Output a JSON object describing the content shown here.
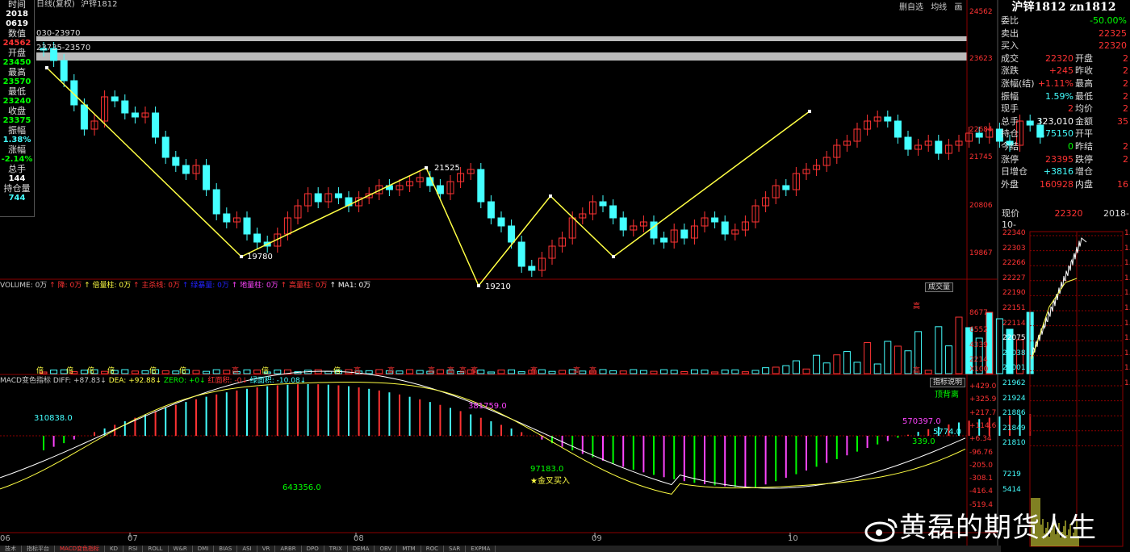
{
  "window": {
    "period": "日线(复权)",
    "symbol": "沪锌1812",
    "top_buttons": [
      "删自选",
      "均线",
      "画"
    ]
  },
  "info_panel": [
    {
      "label": "时间",
      "value": "2018\n0619",
      "color": "#ffffff"
    },
    {
      "label": "数值",
      "value": "24562",
      "color": "#ff3333"
    },
    {
      "label": "开盘",
      "value": "23450",
      "color": "#00ff00"
    },
    {
      "label": "最高",
      "value": "23570",
      "color": "#00ff00"
    },
    {
      "label": "最低",
      "value": "23240",
      "color": "#00ff00"
    },
    {
      "label": "收盘",
      "value": "23375",
      "color": "#00ff00"
    },
    {
      "label": "振幅",
      "value": "1.38%",
      "color": "#44ffff"
    },
    {
      "label": "涨幅",
      "value": "-2.14%",
      "color": "#00ff00"
    },
    {
      "label": "总手",
      "value": "144",
      "color": "#ffffff"
    },
    {
      "label": "持仓量",
      "value": "744",
      "color": "#44ffff"
    }
  ],
  "price_lines": [
    "030-23970",
    "23735-23570"
  ],
  "price_axis": [
    "24562",
    "23623",
    "22684",
    "21745",
    "20806",
    "19867"
  ],
  "zigzag_labels": [
    "19780",
    "21525",
    "19210"
  ],
  "volume": {
    "header": [
      {
        "text": "VOLUME: 0万",
        "color": "#cccccc"
      },
      {
        "text": "↑ 降: 0万",
        "color": "#ff3333"
      },
      {
        "text": "↑ 倍量柱: 0万",
        "color": "#ffff44"
      },
      {
        "text": "↑ 主杀线: 0万",
        "color": "#ff3333"
      },
      {
        "text": "↑ 绿暴量: 0万",
        "color": "#2222ff"
      },
      {
        "text": "↑ 地量柱: 0万",
        "color": "#ff44ff"
      },
      {
        "text": "↑ 高量柱: 0万",
        "color": "#ff3333"
      },
      {
        "text": "↑ MA1: 0万",
        "color": "#ffffff"
      }
    ],
    "button": "成交量",
    "axis": [
      "8677",
      "6552",
      "4339",
      "2214",
      "X100"
    ],
    "markers": [
      "倍",
      "倍",
      "倍",
      "倍",
      "倍",
      "倍",
      "高",
      "倍",
      "倍",
      "高",
      "高",
      "高",
      "高",
      "高",
      "高",
      "高",
      "高",
      "高",
      "高",
      "高"
    ]
  },
  "macd": {
    "header": [
      {
        "text": "MACD变色指标 DIFF: +87.83↓",
        "color": "#cccccc"
      },
      {
        "text": "DEA: +92.88↓",
        "color": "#ffff44"
      },
      {
        "text": "ZERO: +0↓",
        "color": "#00ff00"
      },
      {
        "text": "红面积: -0↓",
        "color": "#ff3333"
      },
      {
        "text": "绿面积: -10.08↓",
        "color": "#44ffff"
      }
    ],
    "button": "指标说明",
    "axis": [
      "+429.0",
      "+325.9",
      "+217.7",
      "+114.6",
      "+6.34",
      "-96.76",
      "-205.0",
      "-308.1",
      "-416.4",
      "-519.4"
    ],
    "labels": [
      {
        "text": "310838.0",
        "color": "#44ffff"
      },
      {
        "text": "381759.0",
        "color": "#ff44ff"
      },
      {
        "text": "643356.0",
        "color": "#00ff00"
      },
      {
        "text": "97183.0",
        "color": "#00ff00"
      },
      {
        "text": "金叉买入",
        "color": "#ffff44"
      },
      {
        "text": "570397.0",
        "color": "#ff44ff"
      },
      {
        "text": "5774.0",
        "color": "#44ffff"
      },
      {
        "text": "339.0",
        "color": "#00ff00"
      },
      {
        "text": "顶背离",
        "color": "#00ff00"
      }
    ]
  },
  "x_axis": [
    "06",
    "07",
    "08",
    "09",
    "10"
  ],
  "right_panel": {
    "title": "沪锌1812 zn1812",
    "rows": [
      {
        "l": "委比",
        "v": "-50.00%",
        "vc": "#00ff00",
        "l2": "",
        "v2": ""
      },
      {
        "l": "卖出",
        "v": "22325",
        "vc": "#ff3333",
        "l2": "",
        "v2": ""
      },
      {
        "l": "买入",
        "v": "22320",
        "vc": "#ff3333",
        "l2": "",
        "v2": ""
      },
      {
        "l": "成交",
        "v": "22320",
        "vc": "#ff3333",
        "l2": "开盘",
        "v2": "2"
      },
      {
        "l": "涨跌",
        "v": "+245",
        "vc": "#ff3333",
        "l2": "昨收",
        "v2": "2"
      },
      {
        "l": "涨幅(结)",
        "v": "+1.11%",
        "vc": "#ff3333",
        "l2": "最高",
        "v2": "2"
      },
      {
        "l": "振幅",
        "v": "1.59%",
        "vc": "#44ffff",
        "l2": "最低",
        "v2": "2"
      },
      {
        "l": "现手",
        "v": "2",
        "vc": "#ff3333",
        "l2": "均价",
        "v2": "2"
      },
      {
        "l": "总手",
        "v": "323,010",
        "vc": "#ffffff",
        "l2": "金额",
        "v2": "35"
      },
      {
        "l": "持仓",
        "v": "175150",
        "vc": "#44ffff",
        "l2": "开平",
        "v2": ""
      },
      {
        "l": "今结",
        "v": "0",
        "vc": "#00ff00",
        "l2": "昨结",
        "v2": "2"
      },
      {
        "l": "涨停",
        "v": "23395",
        "vc": "#ff3333",
        "l2": "跌停",
        "v2": "2"
      },
      {
        "l": "日增仓",
        "v": "+3816",
        "vc": "#44ffff",
        "l2": "增仓",
        "v2": ""
      },
      {
        "l": "外盘",
        "v": "160928",
        "vc": "#ff3333",
        "l2": "内盘",
        "v2": "16"
      }
    ],
    "now": {
      "label": "现价",
      "value": "22320",
      "date": "2018-10-"
    },
    "mini_axis": [
      "22340",
      "22303",
      "22266",
      "22227",
      "22190",
      "22151",
      "22114",
      "22075",
      "22038",
      "22001",
      "21962",
      "21924",
      "21886",
      "21849",
      "21810",
      "7219",
      "5414"
    ],
    "mini_right": [
      "1.",
      "1.",
      "1.",
      "1.",
      "1.",
      "1.",
      "1.",
      "1.",
      "1.",
      "1.",
      "1."
    ]
  },
  "tabs": [
    "技术",
    "指标平台",
    "MACD变色指标",
    "KD",
    "RSI",
    "ROLL",
    "W&R",
    "DMI",
    "BIAS",
    "ASI",
    "VR",
    "ARBR",
    "DPO",
    "TRIX",
    "DEMA",
    "OBV",
    "MTM",
    "ROC",
    "SAR",
    "EXPMA"
  ],
  "watermark": "黄磊的期货人生",
  "colors": {
    "up": "#ff3333",
    "down": "#44ffff",
    "zigzag": "#ffff44",
    "grid": "#8b0000"
  }
}
